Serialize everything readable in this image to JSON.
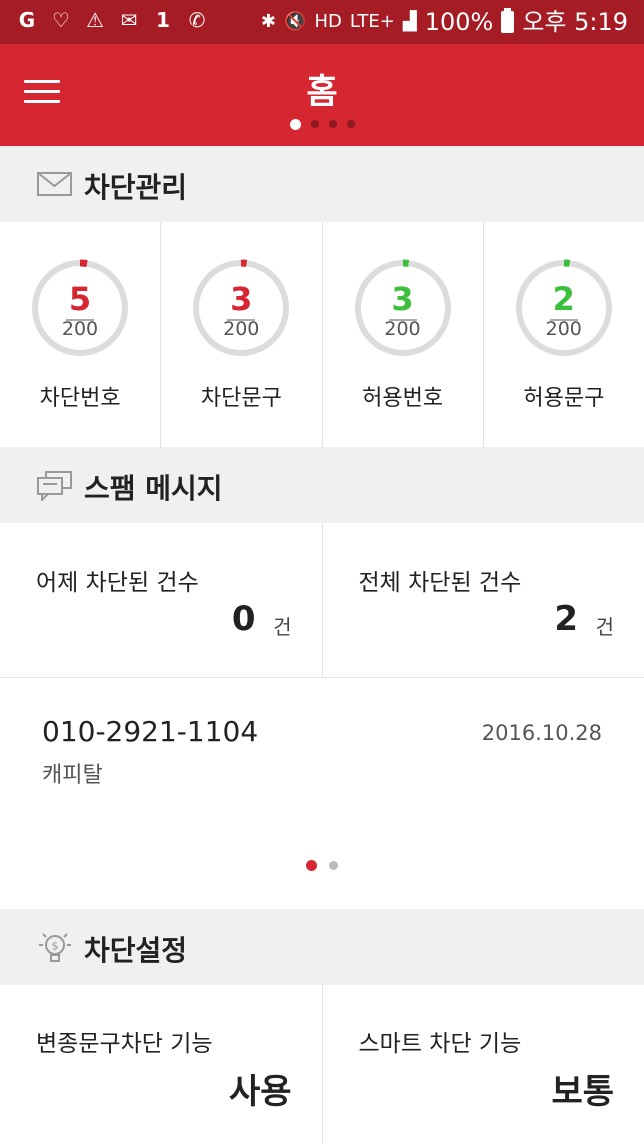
{
  "status_bar": {
    "left_icons": [
      "g-app-icon",
      "heart-app-icon",
      "warning-icon",
      "mail-icon",
      "notification-one-icon",
      "missed-call-icon"
    ],
    "network": "LTE+",
    "battery": "100%",
    "time": "오후 5:19"
  },
  "header": {
    "title": "홈",
    "page_indicator": {
      "count": 4,
      "active": 0
    }
  },
  "block_management": {
    "title": "차단관리",
    "items": [
      {
        "value": "5",
        "max": "200",
        "label": "차단번호",
        "color": "#d62631"
      },
      {
        "value": "3",
        "max": "200",
        "label": "차단문구",
        "color": "#d62631"
      },
      {
        "value": "3",
        "max": "200",
        "label": "허용번호",
        "color": "#3cbf3c"
      },
      {
        "value": "2",
        "max": "200",
        "label": "허용문구",
        "color": "#3cbf3c"
      }
    ]
  },
  "spam": {
    "title": "스팸 메시지",
    "yesterday": {
      "label": "어제 차단된 건수",
      "count": "0",
      "unit": "건"
    },
    "total": {
      "label": "전체 차단된 건수",
      "count": "2",
      "unit": "건"
    },
    "message": {
      "number": "010-2921-1104",
      "sender": "캐피탈",
      "date": "2016.10.28"
    },
    "pager": {
      "count": 2,
      "active": 0
    }
  },
  "block_settings": {
    "title": "차단설정",
    "variant_block": {
      "label": "변종문구차단 기능",
      "value": "사용"
    },
    "smart_block": {
      "label": "스마트 차단 기능",
      "value": "보통"
    }
  },
  "colors": {
    "brand_red": "#d62631",
    "status_bar": "#a51c24",
    "allow_green": "#3cbf3c"
  }
}
